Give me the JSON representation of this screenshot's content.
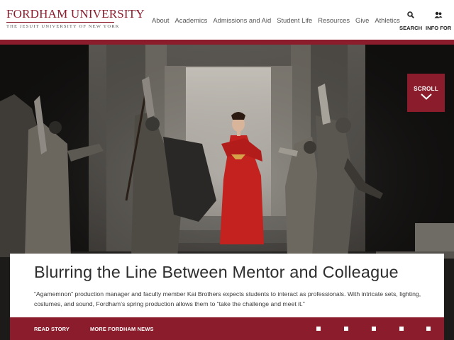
{
  "header": {
    "logo_title": "FORDHAM UNIVERSITY",
    "logo_subtitle": "THE JESUIT UNIVERSITY OF NEW YORK",
    "nav": [
      {
        "label": "About"
      },
      {
        "label": "Academics"
      },
      {
        "label": "Admissions and Aid"
      },
      {
        "label": "Student Life"
      },
      {
        "label": "Resources"
      },
      {
        "label": "Give"
      },
      {
        "label": "Athletics"
      }
    ],
    "search_label": "SEARCH",
    "info_label": "INFO FOR"
  },
  "hero": {
    "scroll_label": "SCROLL"
  },
  "story": {
    "title": "Blurring the Line Between Mentor and Colleague",
    "summary": "“Agamemnon” production manager and faculty member Kai Brothers expects students to interact as professionals. With intricate sets, lighting, costumes, and sound, Fordham’s spring production allows them to “take the challenge and meet it.”",
    "read_label": "READ STORY",
    "more_label": "MORE FORDHAM NEWS",
    "slides": [
      {
        "active": true
      },
      {
        "active": false
      },
      {
        "active": false
      },
      {
        "active": false
      },
      {
        "active": false
      }
    ]
  },
  "colors": {
    "brand_maroon": "#8a1c2c",
    "header_bg": "#ffffff",
    "text_dark": "#2e2e2e"
  },
  "icons": {
    "search": "magnifier-icon",
    "info": "users-icon",
    "scroll": "chevron-down-icon"
  }
}
